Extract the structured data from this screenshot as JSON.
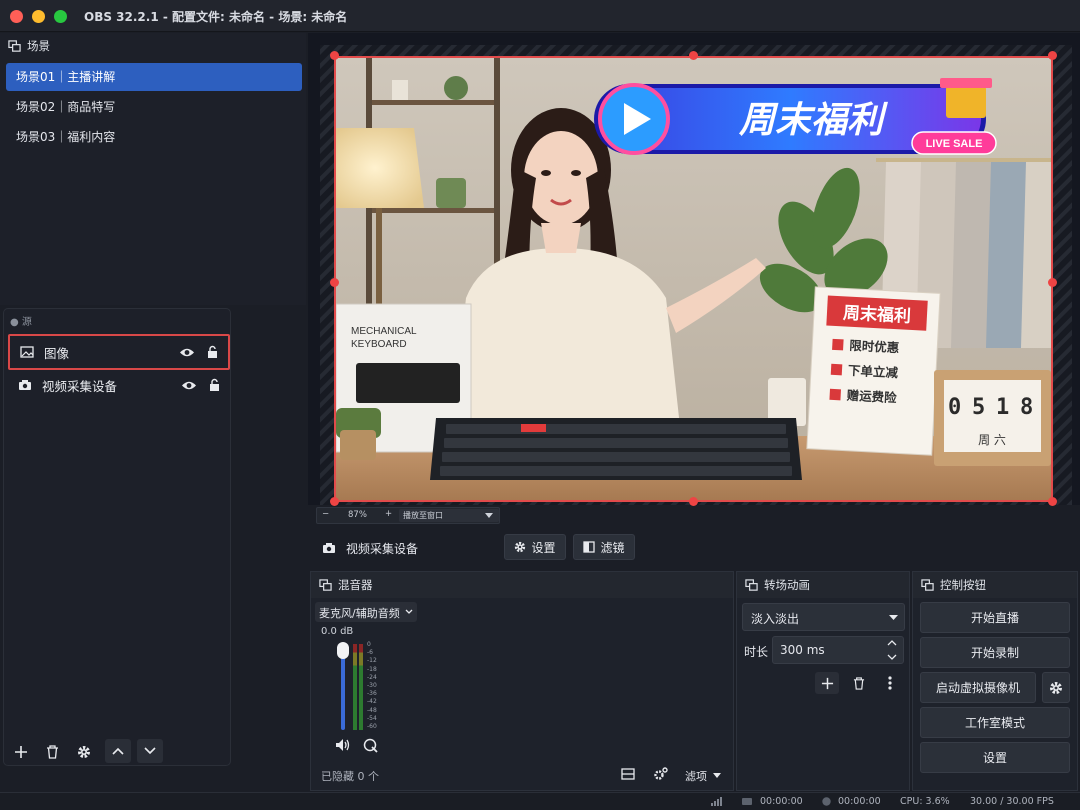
{
  "window": {
    "title": "OBS 32.2.1 - 配置文件: 未命名 - 场景: 未命名"
  },
  "scenes": {
    "header": "场景",
    "items": [
      {
        "label": "场景01｜主播讲解",
        "selected": true
      },
      {
        "label": "场景02｜商品特写",
        "selected": false
      },
      {
        "label": "场景03｜福利内容",
        "selected": false
      }
    ]
  },
  "sources": {
    "header": "源",
    "items": [
      {
        "label": "图像",
        "icon": "image-icon",
        "selected": true
      },
      {
        "label": "视频采集设备",
        "icon": "camera-icon",
        "selected": false
      }
    ]
  },
  "preview": {
    "zoom": "87%",
    "zoom_minus": "−",
    "zoom_plus": "+",
    "scale_mode": "播放至窗口",
    "banner": {
      "title": "周末福利",
      "badge": "LIVE SALE"
    },
    "box": {
      "line1": "MECHANICAL",
      "line2": "KEYBOARD"
    },
    "sign": {
      "title": "周末福利",
      "items": [
        "限时优惠",
        "下单立减",
        "赠运费险"
      ]
    },
    "calendar": {
      "digits": [
        "0",
        "5",
        "1",
        "8"
      ],
      "weekday": "周 六"
    }
  },
  "source_toolbar": {
    "source_name": "视频采集设备",
    "settings": "设置",
    "filters": "滤镜"
  },
  "mixer": {
    "header": "混音器",
    "channel": "麦克风/辅助音频",
    "db": "0.0 dB",
    "scale": [
      "0",
      "-6",
      "-12",
      "-18",
      "-24",
      "-30",
      "-36",
      "-42",
      "-48",
      "-54",
      "-60"
    ],
    "hidden": "已隐藏 0 个",
    "menu": "滤项"
  },
  "transitions": {
    "header": "转场动画",
    "selected": "淡入淡出",
    "duration_label": "时长",
    "duration_value": "300 ms"
  },
  "controls": {
    "header": "控制按钮",
    "start_stream": "开始直播",
    "start_record": "开始录制",
    "virtual_cam": "启动虚拟摄像机",
    "studio_mode": "工作室模式",
    "settings": "设置"
  },
  "status": {
    "stream_time": "00:00:00",
    "record_time": "00:00:00",
    "cpu": "CPU: 3.6%",
    "fps": "30.00 / 30.00 FPS"
  },
  "colors": {
    "accent": "#2d5fbf",
    "selection_border": "#d94848",
    "close": "#ff5f57",
    "minimize": "#febc2e",
    "maximize": "#28c840"
  }
}
